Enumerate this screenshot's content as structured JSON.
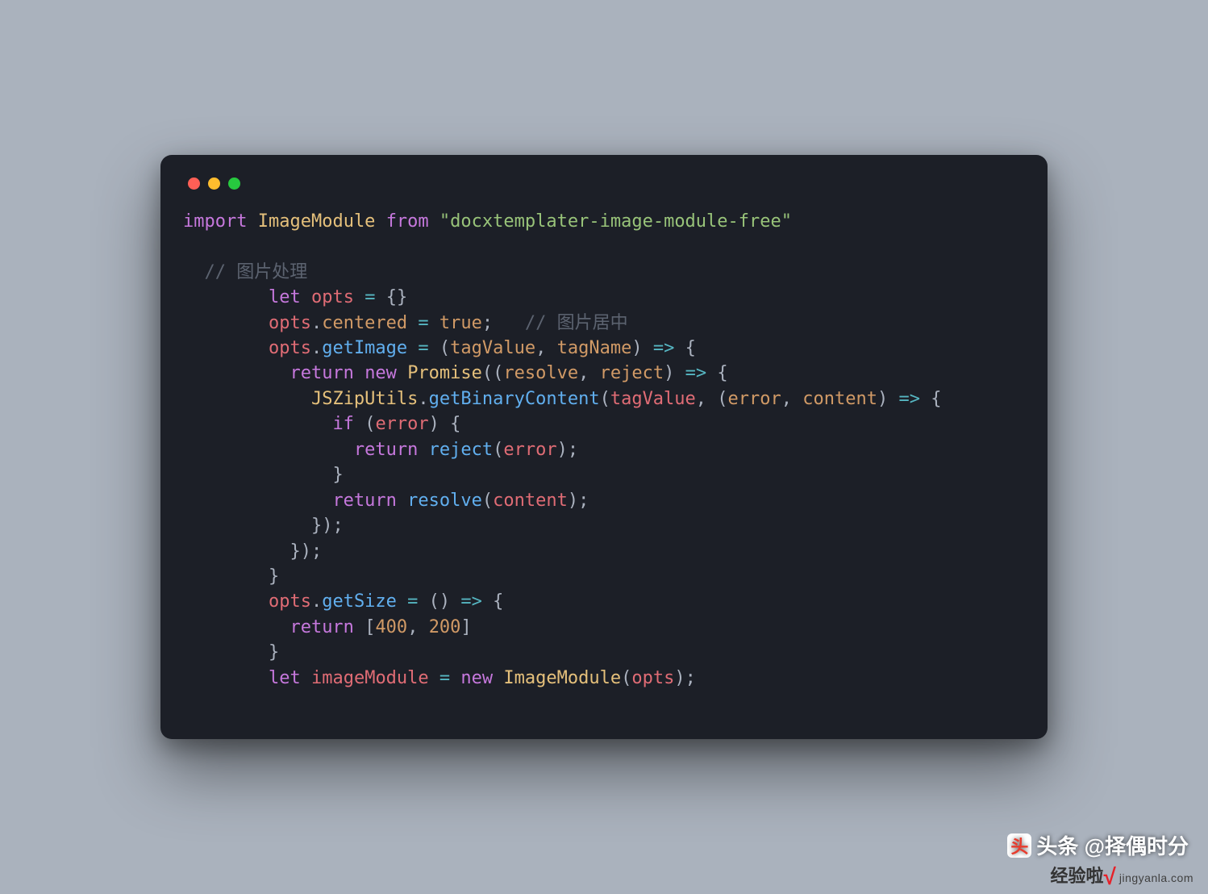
{
  "colors": {
    "page_bg": "#aab2bd",
    "window_bg": "#1c1f27",
    "traffic_red": "#ff5f56",
    "traffic_yellow": "#ffbd2e",
    "traffic_green": "#27c93f"
  },
  "code": {
    "l1": {
      "import": "import",
      "sp1": " ",
      "ImageModule": "ImageModule",
      "sp2": " ",
      "from": "from",
      "sp3": " ",
      "str": "\"docxtemplater-image-module-free\""
    },
    "l2": "",
    "l3": {
      "indent": "  ",
      "comment": "// 图片处理"
    },
    "l4": {
      "indent": "        ",
      "let": "let",
      "sp": " ",
      "opts": "opts",
      "sp2": " ",
      "eq": "=",
      "sp3": " ",
      "braces": "{}"
    },
    "l5": {
      "indent": "        ",
      "opts": "opts",
      "dot": ".",
      "centered": "centered",
      "sp": " ",
      "eq": "=",
      "sp2": " ",
      "true": "true",
      "semi": ";",
      "sp3": "   ",
      "comment": "// 图片居中"
    },
    "l6": {
      "indent": "        ",
      "opts": "opts",
      "dot": ".",
      "getImage": "getImage",
      "sp": " ",
      "eq": "=",
      "sp2": " ",
      "lp": "(",
      "tagValue": "tagValue",
      "comma": ", ",
      "tagName": "tagName",
      "rp": ")",
      "sp3": " ",
      "arrow": "=>",
      "sp4": " ",
      "lb": "{"
    },
    "l7": {
      "indent": "          ",
      "return": "return",
      "sp": " ",
      "new": "new",
      "sp2": " ",
      "Promise": "Promise",
      "lp": "(",
      "lp2": "(",
      "resolve": "resolve",
      "comma": ", ",
      "reject": "reject",
      "rp": ")",
      "sp3": " ",
      "arrow": "=>",
      "sp4": " ",
      "lb": "{"
    },
    "l8": {
      "indent": "            ",
      "JSZipUtils": "JSZipUtils",
      "dot": ".",
      "getBinaryContent": "getBinaryContent",
      "lp": "(",
      "tagValue": "tagValue",
      "comma": ", ",
      "lp2": "(",
      "error": "error",
      "comma2": ", ",
      "content": "content",
      "rp": ")",
      "sp": " ",
      "arrow": "=>",
      "sp2": " ",
      "lb": "{"
    },
    "l9": {
      "indent": "              ",
      "if": "if",
      "sp": " ",
      "lp": "(",
      "error": "error",
      "rp": ")",
      "sp2": " ",
      "lb": "{"
    },
    "l10": {
      "indent": "                ",
      "return": "return",
      "sp": " ",
      "reject": "reject",
      "lp": "(",
      "error": "error",
      "rp": ")",
      "semi": ";"
    },
    "l11": {
      "indent": "              ",
      "rb": "}"
    },
    "l12": {
      "indent": "              ",
      "return": "return",
      "sp": " ",
      "resolve": "resolve",
      "lp": "(",
      "content": "content",
      "rp": ")",
      "semi": ";"
    },
    "l13": {
      "indent": "            ",
      "rb": "});"
    },
    "l14": {
      "indent": "          ",
      "rb": "});"
    },
    "l15": {
      "indent": "        ",
      "rb": "}"
    },
    "l16": {
      "indent": "        ",
      "opts": "opts",
      "dot": ".",
      "getSize": "getSize",
      "sp": " ",
      "eq": "=",
      "sp2": " ",
      "lp": "(",
      "rp": ")",
      "sp3": " ",
      "arrow": "=>",
      "sp4": " ",
      "lb": "{"
    },
    "l17": {
      "indent": "          ",
      "return": "return",
      "sp": " ",
      "lb": "[",
      "n1": "400",
      "comma": ", ",
      "n2": "200",
      "rb": "]"
    },
    "l18": {
      "indent": "        ",
      "rb": "}"
    },
    "l19": {
      "indent": "        ",
      "let": "let",
      "sp": " ",
      "imageModule": "imageModule",
      "sp2": " ",
      "eq": "=",
      "sp3": " ",
      "new": "new",
      "sp4": " ",
      "ImageModule": "ImageModule",
      "lp": "(",
      "opts": "opts",
      "rp": ")",
      "semi": ";"
    }
  },
  "watermarks": {
    "toutiao_prefix": "头条",
    "toutiao_at": " @择偶时分",
    "jingyanla_text": "经验啦",
    "jingyanla_check": "√",
    "jingyanla_url": "jingyanla.com"
  }
}
